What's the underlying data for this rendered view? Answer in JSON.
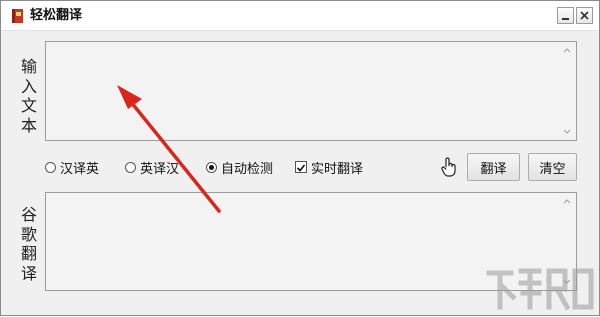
{
  "window": {
    "title": "轻松翻译",
    "icon": "app-book-icon"
  },
  "labels": {
    "input": "输入文本",
    "output": "谷歌翻译"
  },
  "options": [
    {
      "label": "汉译英",
      "type": "radio",
      "checked": false
    },
    {
      "label": "英译汉",
      "type": "radio",
      "checked": false
    },
    {
      "label": "自动检测",
      "type": "radio",
      "checked": true
    },
    {
      "label": "实时翻译",
      "type": "checkbox",
      "checked": true
    }
  ],
  "buttons": {
    "translate": "翻译",
    "clear": "清空"
  },
  "input_text": "",
  "output_text": "",
  "colors": {
    "annotation_arrow": "#d9261c",
    "watermark": "#9a9a9a"
  }
}
